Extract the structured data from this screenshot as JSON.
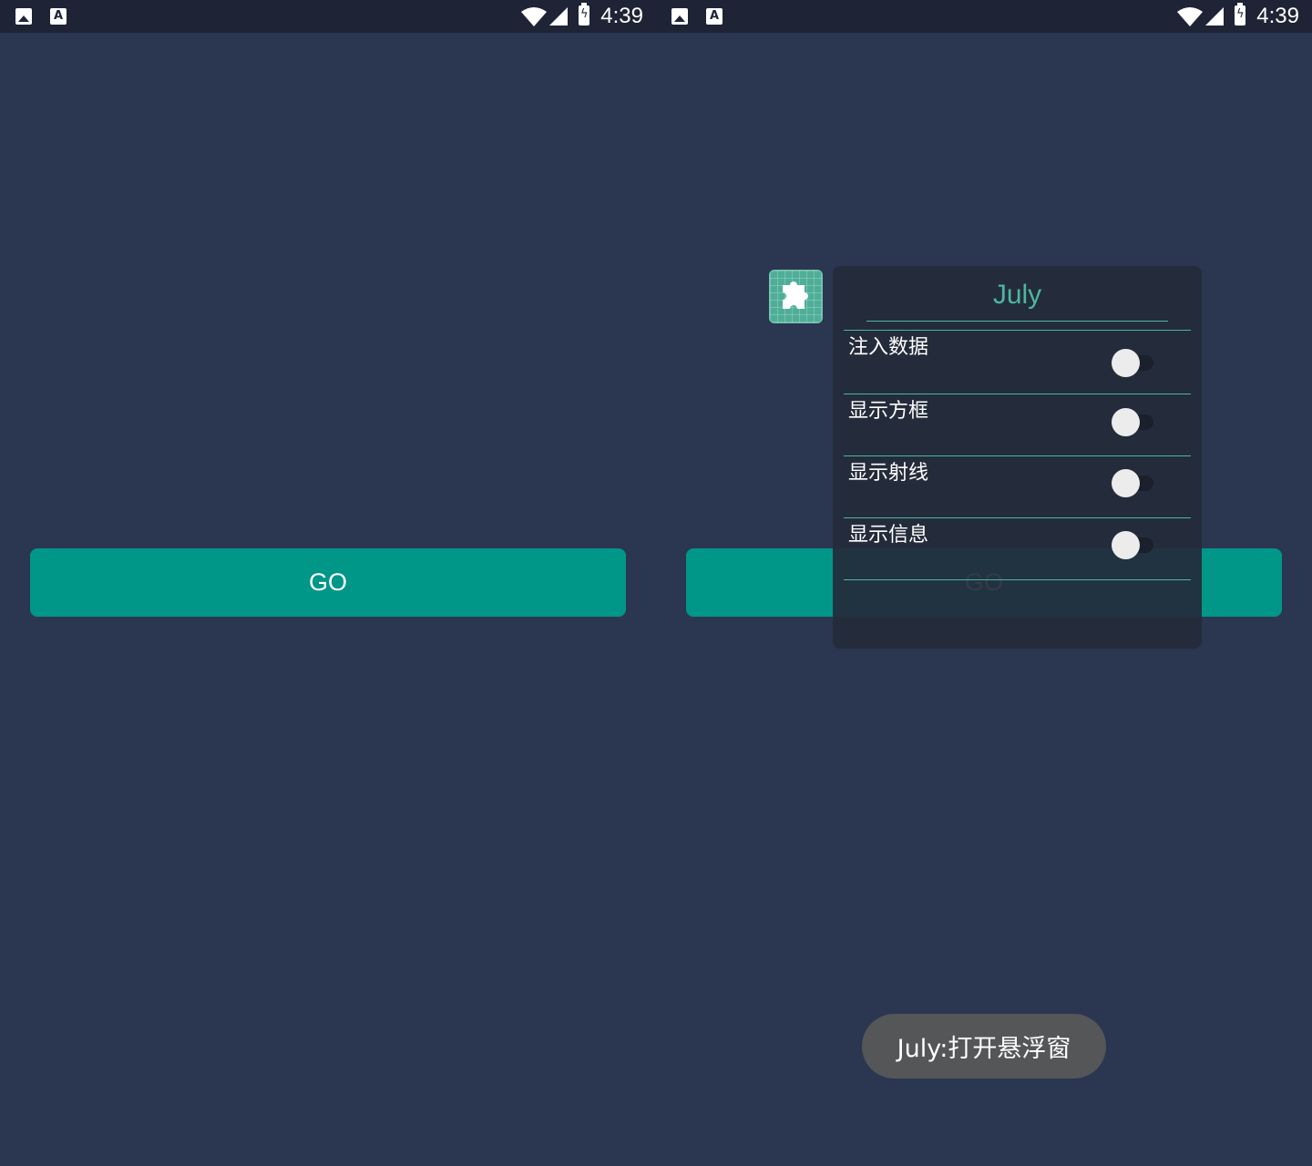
{
  "status_bar": {
    "time": "4:39",
    "icons": [
      "image-icon",
      "a-icon",
      "wifi-icon",
      "signal-icon",
      "battery-charging-icon"
    ]
  },
  "left_screen": {
    "go_button": "GO"
  },
  "right_screen": {
    "go_button": "GO",
    "floating_icon": "puzzle-icon",
    "panel": {
      "title": "July",
      "items": [
        {
          "label": "注入数据",
          "enabled": false
        },
        {
          "label": "显示方框",
          "enabled": false
        },
        {
          "label": "显示射线",
          "enabled": false
        },
        {
          "label": "显示信息",
          "enabled": false
        }
      ]
    },
    "toast": "July:打开悬浮窗"
  },
  "colors": {
    "background": "#2b3650",
    "status_bar": "#1e2435",
    "accent": "#009688",
    "panel_accent": "#4db6a0",
    "toast": "#555657"
  }
}
